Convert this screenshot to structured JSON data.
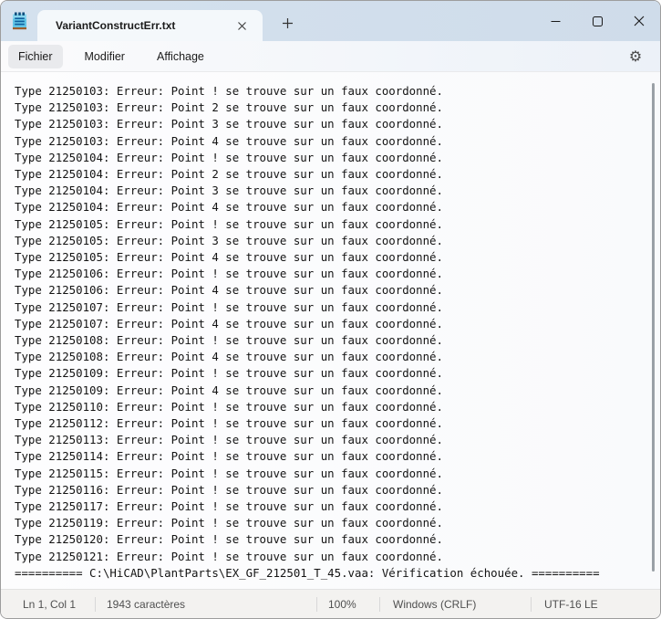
{
  "window": {
    "app": "Notepad",
    "colors": {
      "titlebar_bg": "#d2dfee",
      "tab_bg": "#f4f8fb",
      "editor_bg": "#fbfcfd",
      "statusbar_bg": "#f3f2f0",
      "icon_blue": "#54bfe4",
      "icon_line_blue": "#0f5e9c",
      "icon_base_brown": "#9c5f2e"
    }
  },
  "titlebar": {
    "tab_label": "VariantConstructErr.txt",
    "icons": {
      "app": "notepad-icon",
      "tab_close": "close-icon",
      "new_tab": "plus-icon",
      "minimize": "minimize-icon",
      "maximize": "maximize-icon",
      "close": "close-icon"
    }
  },
  "menubar": {
    "items": {
      "file": "Fichier",
      "edit": "Modifier",
      "view": "Affichage"
    },
    "gear_glyph": "⚙"
  },
  "editor": {
    "lines": [
      "Type 21250103: Erreur: Point ! se trouve sur un faux coordonné.",
      "Type 21250103: Erreur: Point 2 se trouve sur un faux coordonné.",
      "Type 21250103: Erreur: Point 3 se trouve sur un faux coordonné.",
      "Type 21250103: Erreur: Point 4 se trouve sur un faux coordonné.",
      "Type 21250104: Erreur: Point ! se trouve sur un faux coordonné.",
      "Type 21250104: Erreur: Point 2 se trouve sur un faux coordonné.",
      "Type 21250104: Erreur: Point 3 se trouve sur un faux coordonné.",
      "Type 21250104: Erreur: Point 4 se trouve sur un faux coordonné.",
      "Type 21250105: Erreur: Point ! se trouve sur un faux coordonné.",
      "Type 21250105: Erreur: Point 3 se trouve sur un faux coordonné.",
      "Type 21250105: Erreur: Point 4 se trouve sur un faux coordonné.",
      "Type 21250106: Erreur: Point ! se trouve sur un faux coordonné.",
      "Type 21250106: Erreur: Point 4 se trouve sur un faux coordonné.",
      "Type 21250107: Erreur: Point ! se trouve sur un faux coordonné.",
      "Type 21250107: Erreur: Point 4 se trouve sur un faux coordonné.",
      "Type 21250108: Erreur: Point ! se trouve sur un faux coordonné.",
      "Type 21250108: Erreur: Point 4 se trouve sur un faux coordonné.",
      "Type 21250109: Erreur: Point ! se trouve sur un faux coordonné.",
      "Type 21250109: Erreur: Point 4 se trouve sur un faux coordonné.",
      "Type 21250110: Erreur: Point ! se trouve sur un faux coordonné.",
      "Type 21250112: Erreur: Point ! se trouve sur un faux coordonné.",
      "Type 21250113: Erreur: Point ! se trouve sur un faux coordonné.",
      "Type 21250114: Erreur: Point ! se trouve sur un faux coordonné.",
      "Type 21250115: Erreur: Point ! se trouve sur un faux coordonné.",
      "Type 21250116: Erreur: Point ! se trouve sur un faux coordonné.",
      "Type 21250117: Erreur: Point ! se trouve sur un faux coordonné.",
      "Type 21250119: Erreur: Point ! se trouve sur un faux coordonné.",
      "Type 21250120: Erreur: Point ! se trouve sur un faux coordonné.",
      "Type 21250121: Erreur: Point ! se trouve sur un faux coordonné.",
      "========== C:\\HiCAD\\PlantParts\\EX_GF_212501_T_45.vaa: Vérification échouée. =========="
    ]
  },
  "statusbar": {
    "cursor_position": "Ln 1, Col 1",
    "character_count": "1943 caractères",
    "zoom_level": "100%",
    "line_endings": "Windows (CRLF)",
    "encoding": "UTF-16 LE"
  }
}
